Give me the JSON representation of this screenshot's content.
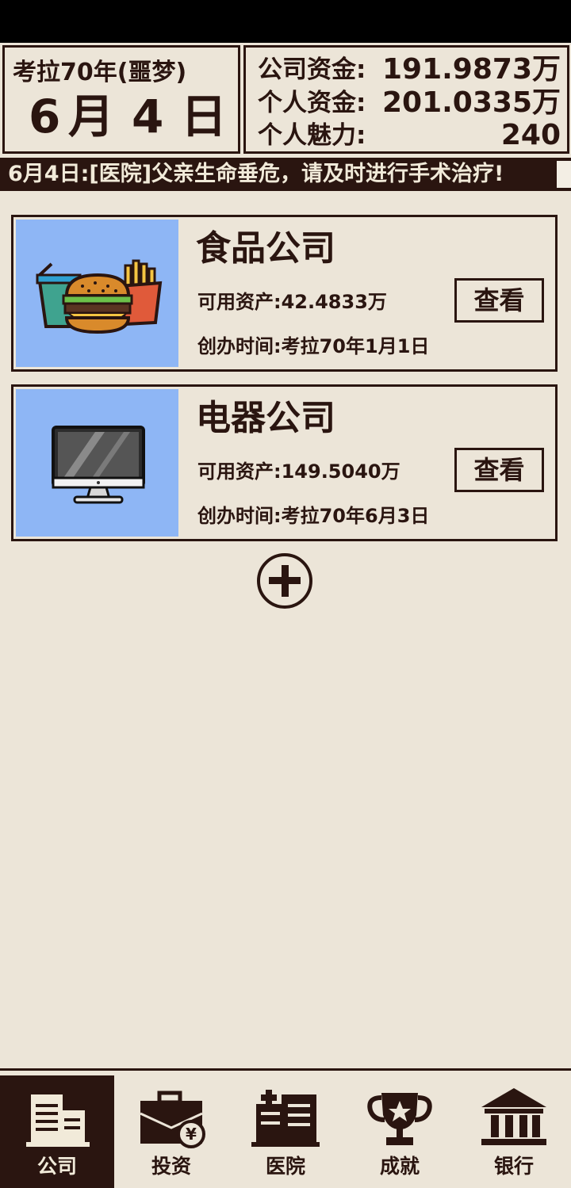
{
  "header": {
    "era": "考拉70年(噩梦)",
    "date": {
      "month": "6",
      "month_unit": "月",
      "day": "4",
      "day_unit": "日"
    },
    "stats": [
      {
        "label": "公司资金:",
        "value": "191.9873万"
      },
      {
        "label": "个人资金:",
        "value": "201.0335万"
      },
      {
        "label": "个人魅力:",
        "value": "240"
      }
    ]
  },
  "ticker": {
    "message": "6月4日:[医院]父亲生命垂危，请及时进行手术治疗!"
  },
  "companies": [
    {
      "name": "食品公司",
      "assets": "可用资产:42.4833万",
      "founded": "创办时间:考拉70年1月1日",
      "view_label": "查看",
      "icon": "fast-food-icon"
    },
    {
      "name": "电器公司",
      "assets": "可用资产:149.5040万",
      "founded": "创办时间:考拉70年6月3日",
      "view_label": "查看",
      "icon": "monitor-icon"
    }
  ],
  "add_button": {
    "icon": "plus-circle-icon"
  },
  "nav": [
    {
      "label": "公司",
      "icon": "building-icon",
      "active": true
    },
    {
      "label": "投资",
      "icon": "briefcase-yen-icon",
      "active": false
    },
    {
      "label": "医院",
      "icon": "hospital-icon",
      "active": false
    },
    {
      "label": "成就",
      "icon": "trophy-icon",
      "active": false
    },
    {
      "label": "银行",
      "icon": "bank-icon",
      "active": false
    }
  ],
  "colors": {
    "primary": "#2a1510",
    "background": "#ece5d8",
    "card_image_bg": "#8eb6f5"
  }
}
